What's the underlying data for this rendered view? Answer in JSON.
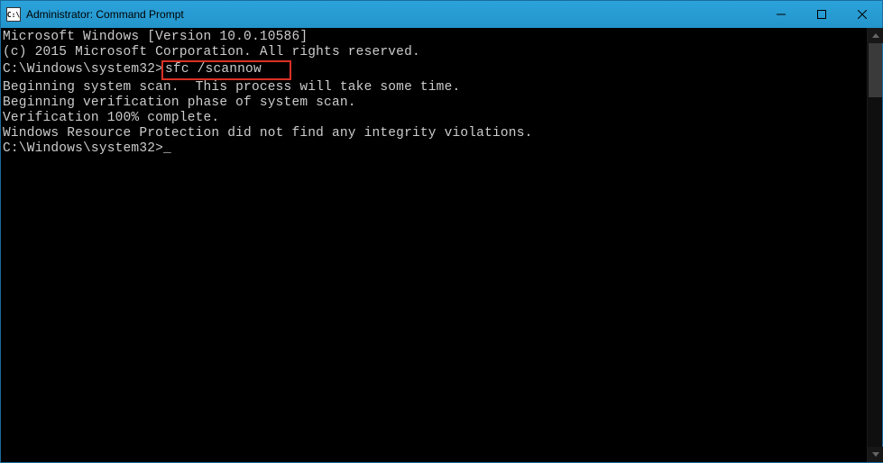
{
  "titlebar": {
    "icon_text": "C:\\",
    "title": "Administrator: Command Prompt"
  },
  "terminal": {
    "line1": "Microsoft Windows [Version 10.0.10586]",
    "line2": "(c) 2015 Microsoft Corporation. All rights reserved.",
    "blank": "",
    "prompt1_prefix": "C:\\Windows\\system32>",
    "prompt1_cmd": "sfc /scannow",
    "line3": "Beginning system scan.  This process will take some time.",
    "line4": "Beginning verification phase of system scan.",
    "line5": "Verification 100% complete.",
    "line6": "Windows Resource Protection did not find any integrity violations.",
    "prompt2": "C:\\Windows\\system32>"
  },
  "cursor": "_"
}
